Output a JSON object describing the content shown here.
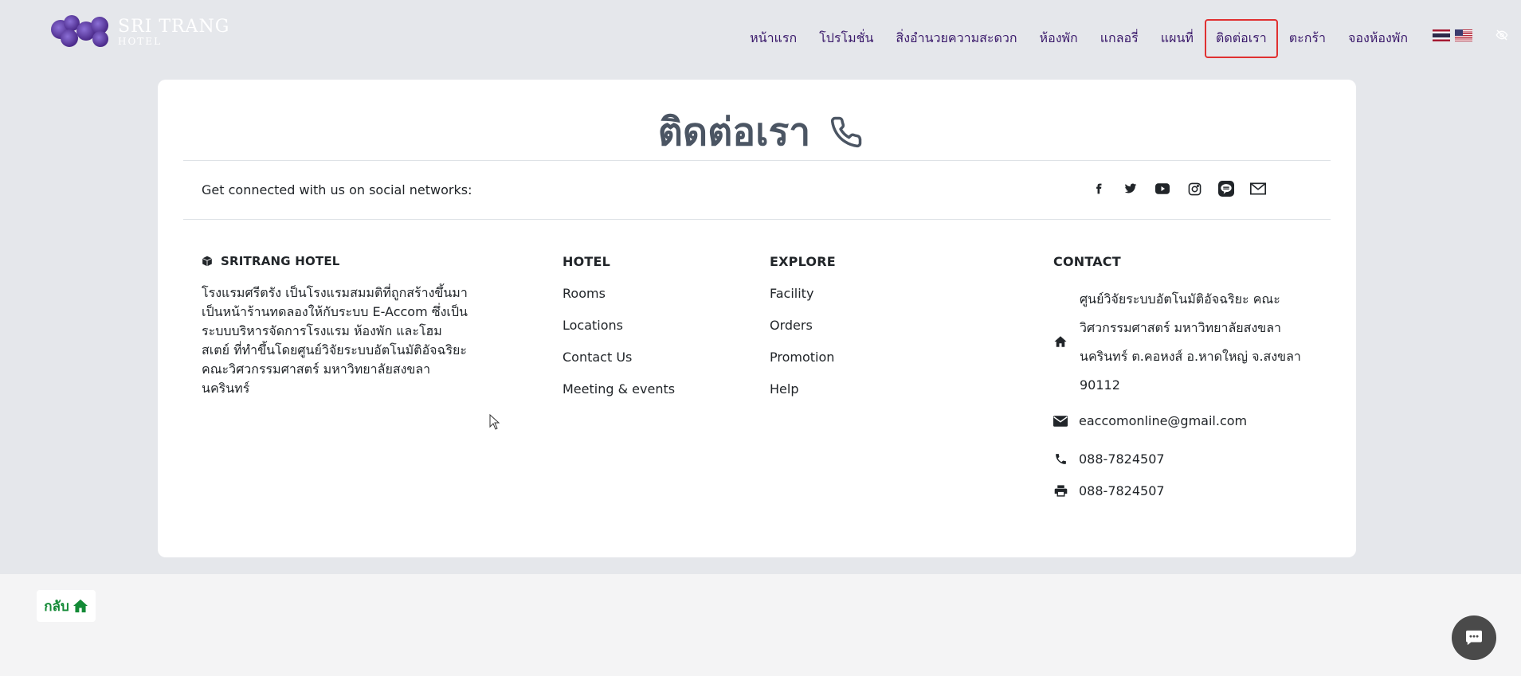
{
  "brand": {
    "title": "SRI TRANG",
    "subtitle": "HOTEL"
  },
  "nav": {
    "items": [
      {
        "label": "หน้าแรก"
      },
      {
        "label": "โปรโมชั่น"
      },
      {
        "label": "สิ่งอำนวยความสะดวก"
      },
      {
        "label": "ห้องพัก"
      },
      {
        "label": "แกลอรี่"
      },
      {
        "label": "แผนที่"
      },
      {
        "label": "ติดต่อเรา",
        "active": true
      },
      {
        "label": "ตะกร้า"
      },
      {
        "label": "จองห้องพัก"
      }
    ],
    "accent_active_border": "#e03131",
    "text_color": "#3b1a6b"
  },
  "contact_page": {
    "title": "ติดต่อเรา",
    "social_text": "Get connected with us on social networks:",
    "social_icons": [
      "facebook-icon",
      "twitter-icon",
      "youtube-icon",
      "instagram-icon",
      "line-icon",
      "mail-icon"
    ]
  },
  "about": {
    "title": "SRITRANG HOTEL",
    "description": "โรงแรมศรีตรัง เป็นโรงแรมสมมติที่ถูกสร้างขึ้นมาเป็นหน้าร้านทดลองให้กับระบบ E-Accom ซึ่งเป็นระบบบริหารจัดการโรงแรม ห้องพัก และโฮมสเตย์ ที่ทำขึ้นโดยศูนย์วิจัยระบบอัตโนมัติอัจฉริยะ คณะวิศวกรรมศาสตร์ มหาวิทยาลัยสงขลานครินทร์"
  },
  "hotel_links": {
    "title": "HOTEL",
    "items": [
      "Rooms",
      "Locations",
      "Contact Us",
      "Meeting & events"
    ]
  },
  "explore_links": {
    "title": "EXPLORE",
    "items": [
      "Facility",
      "Orders",
      "Promotion",
      "Help"
    ]
  },
  "contact": {
    "title": "CONTACT",
    "address": "ศูนย์วิจัยระบบอัตโนมัติอัจฉริยะ คณะวิศวกรรมศาสตร์ มหาวิทยาลัยสงขลานครินทร์ ต.คอหงส์ อ.หาดใหญ่ จ.สงขลา 90112",
    "email": "eaccomonline@gmail.com",
    "phone": "088-7824507",
    "fax": "088-7824507"
  },
  "footer": {
    "back_label": "กลับ",
    "back_color": "#138a36"
  }
}
